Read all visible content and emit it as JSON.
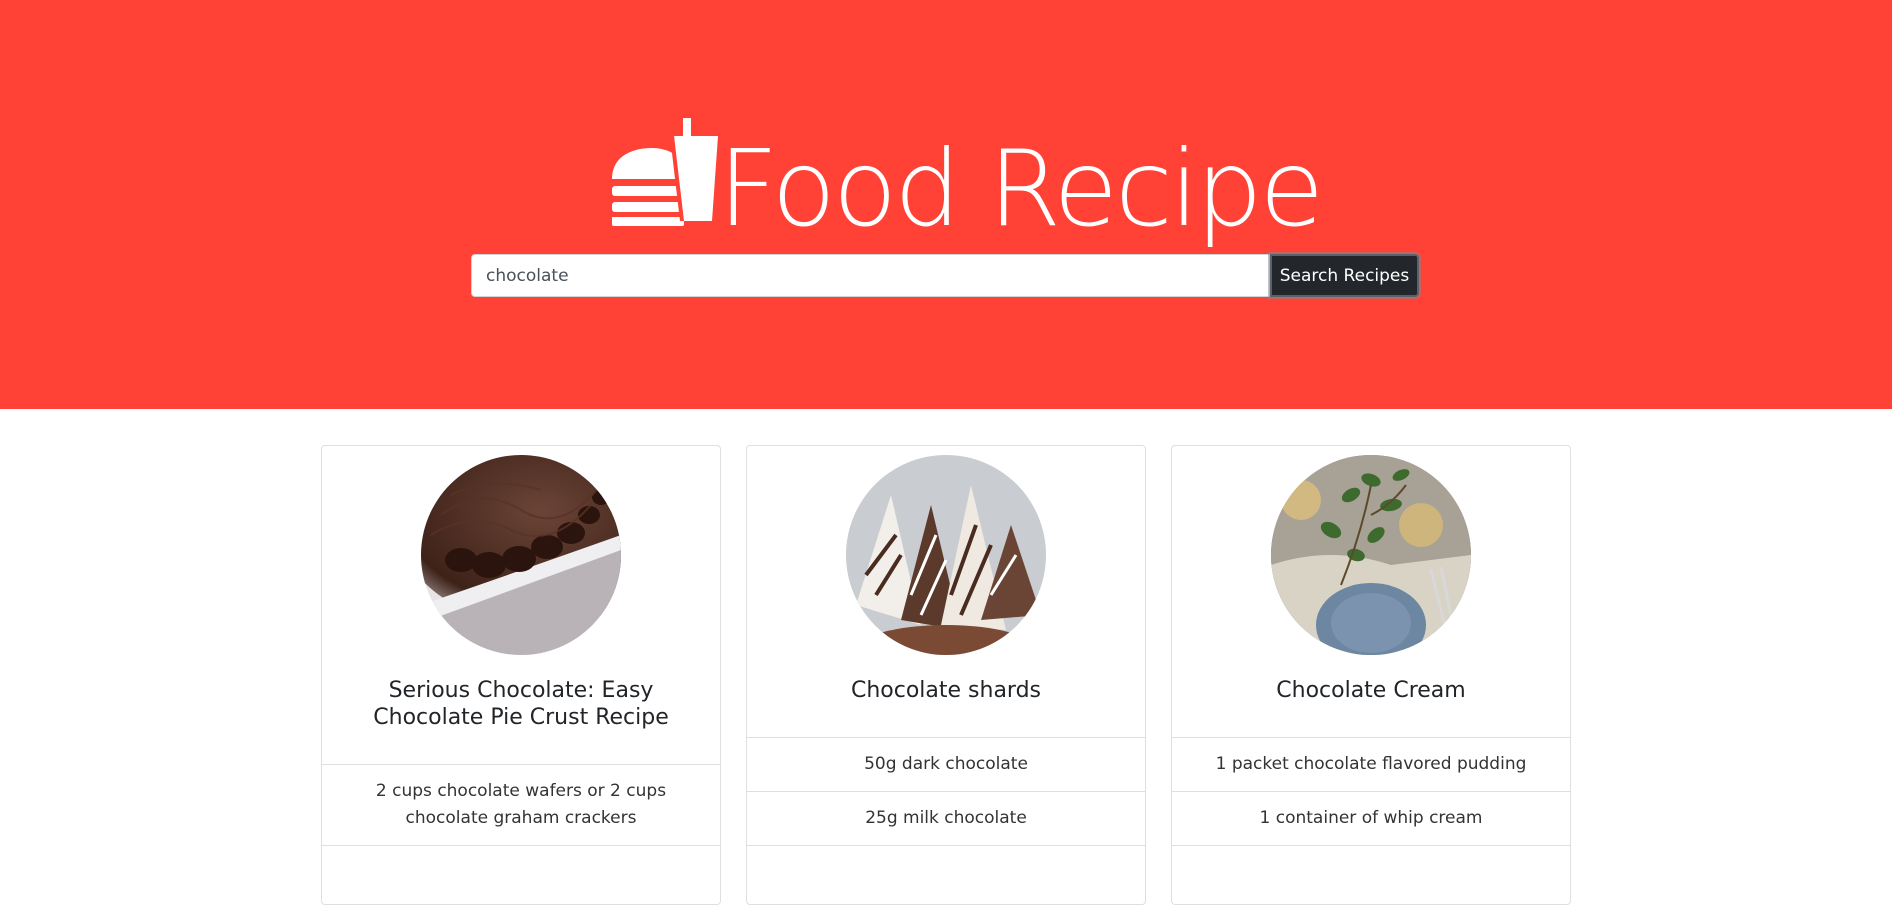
{
  "app": {
    "title": "Food Recipe",
    "logo_icon": "burger-drink-icon"
  },
  "colors": {
    "hero_background": "#ff4136",
    "button_background": "#23272b"
  },
  "search": {
    "value": "chocolate",
    "button_label": "Search Recipes"
  },
  "recipes": [
    {
      "title": "Serious Chocolate: Easy Chocolate Pie Crust Recipe",
      "image": "chocolate-pie-crust-photo",
      "ingredients": [
        "2 cups chocolate wafers or 2 cups chocolate graham crackers"
      ]
    },
    {
      "title": "Chocolate shards",
      "image": "chocolate-shards-photo",
      "ingredients": [
        "50g dark chocolate",
        "25g milk chocolate"
      ]
    },
    {
      "title": "Chocolate Cream",
      "image": "table-setting-photo",
      "ingredients": [
        "1 packet chocolate flavored pudding",
        "1 container of whip cream"
      ]
    }
  ]
}
